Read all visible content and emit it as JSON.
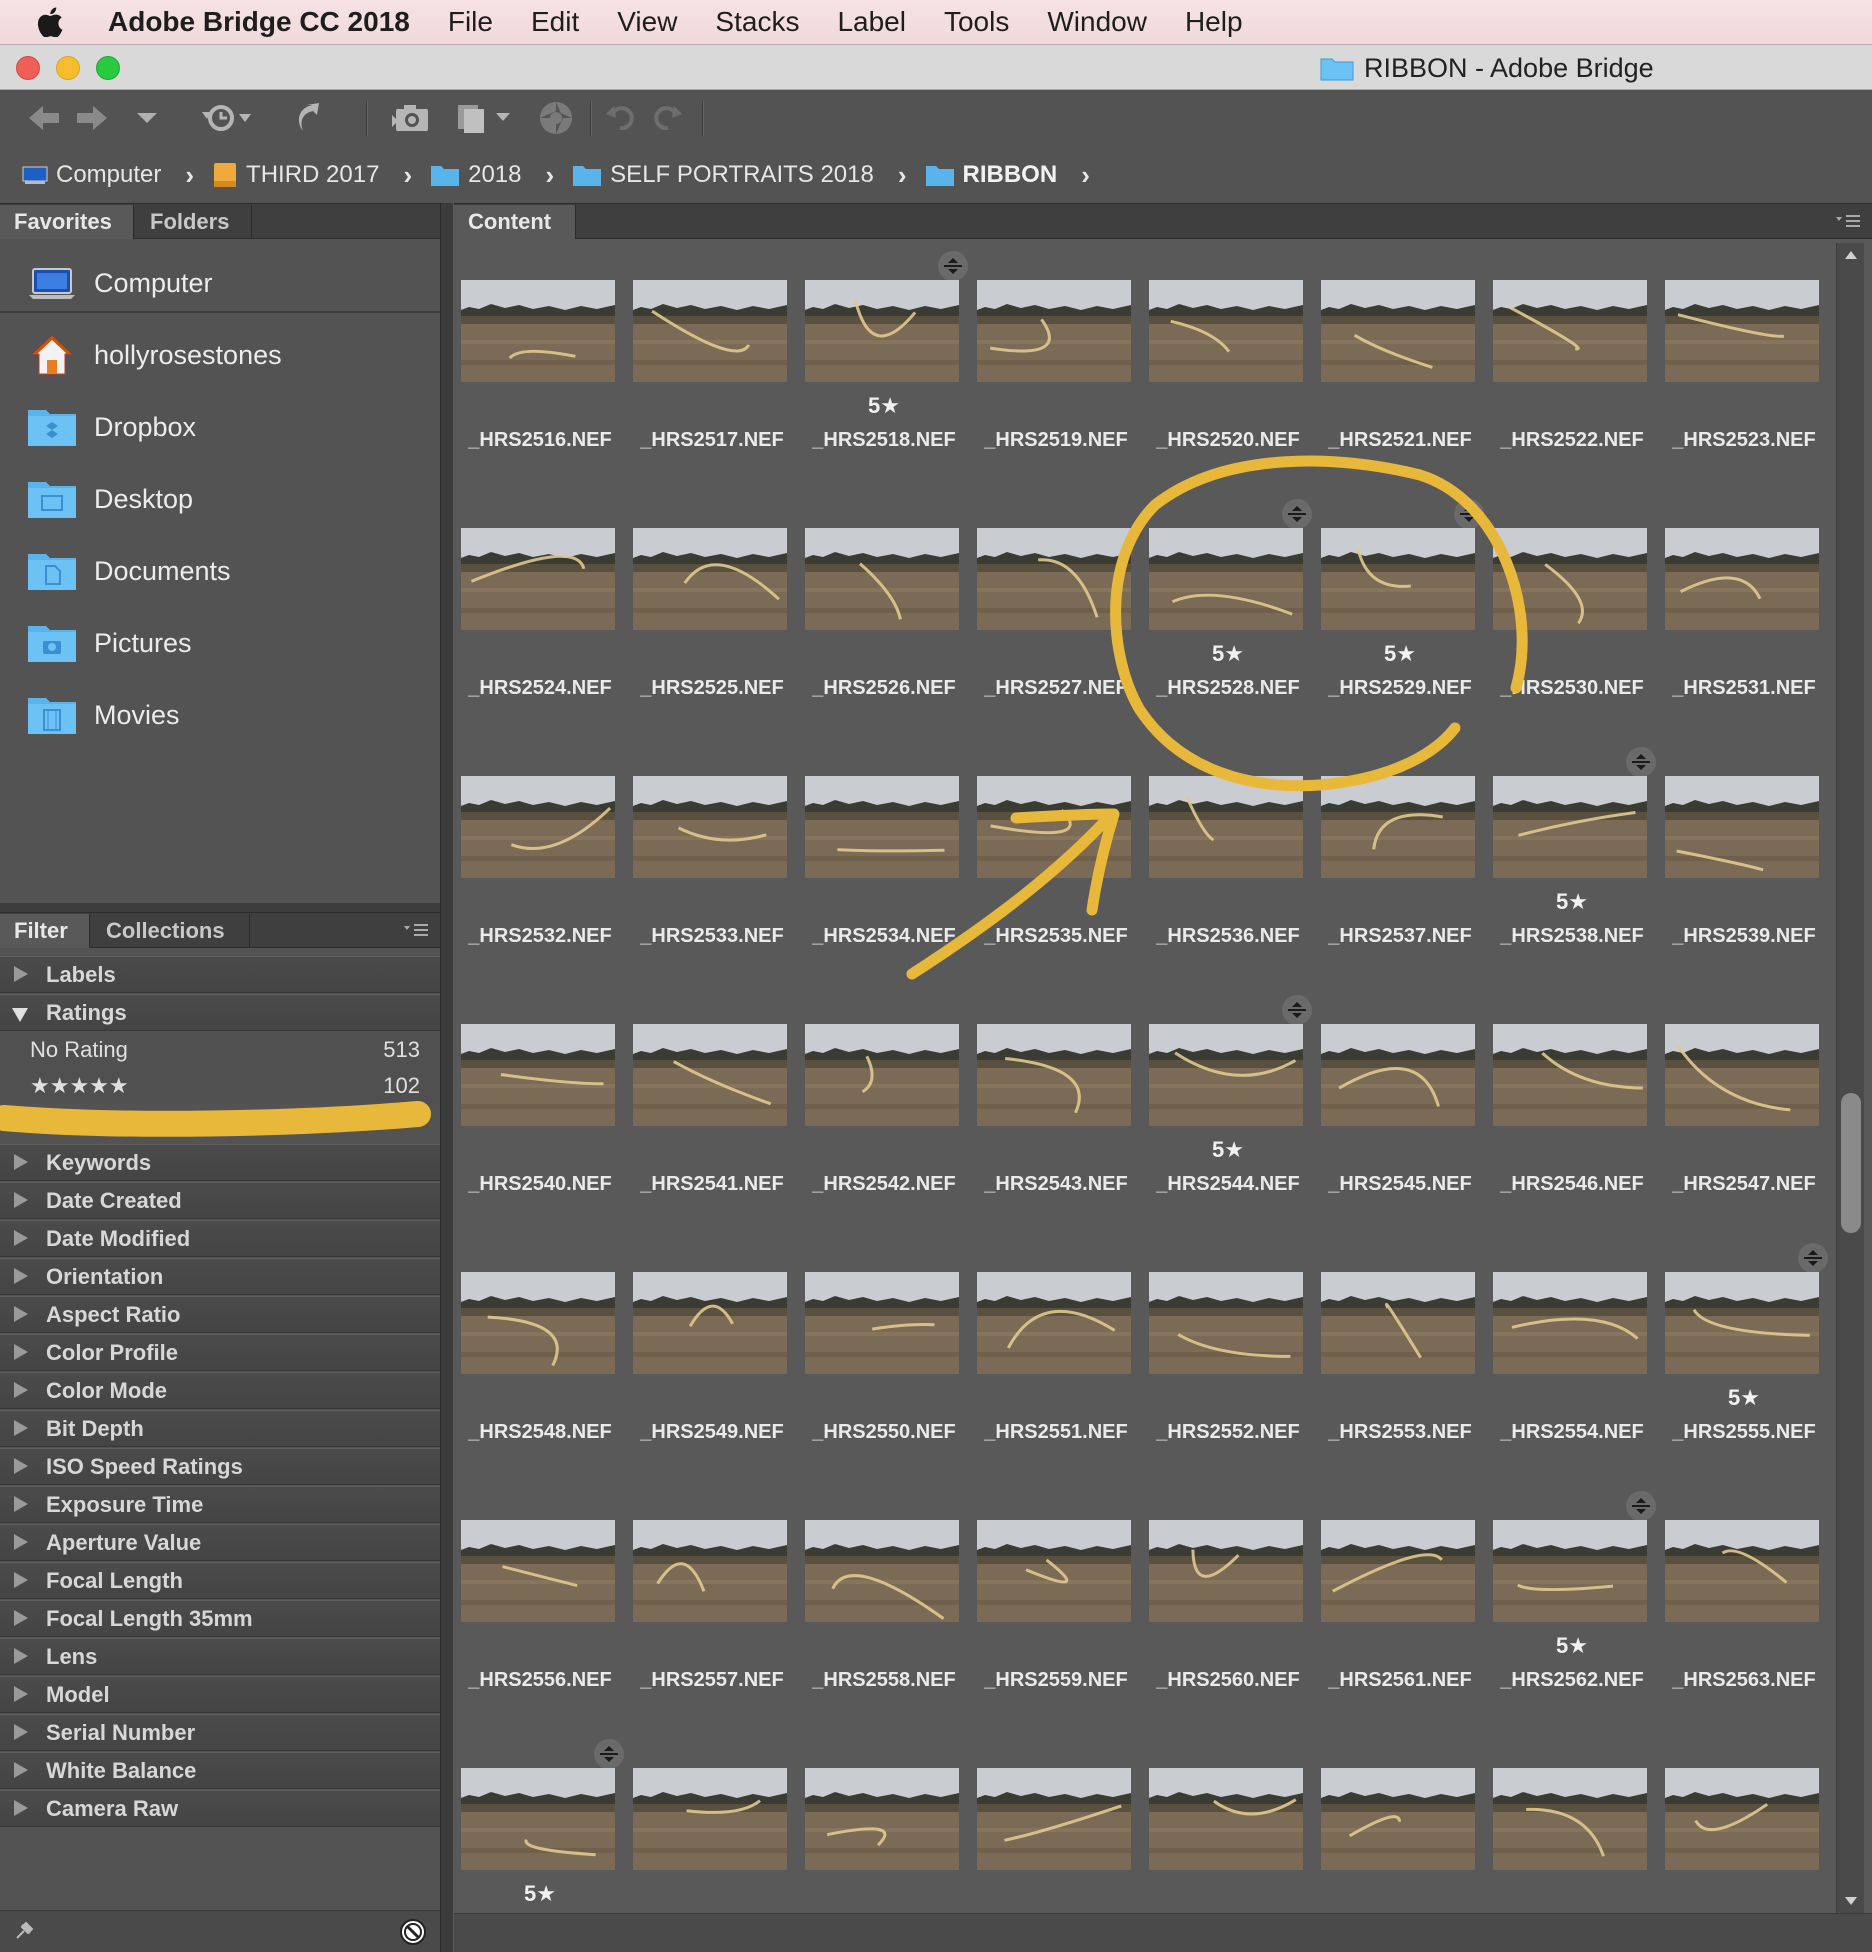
{
  "menubar": {
    "app_name": "Adobe Bridge CC 2018",
    "items": [
      "File",
      "Edit",
      "View",
      "Stacks",
      "Label",
      "Tools",
      "Window",
      "Help"
    ]
  },
  "window": {
    "title": "RIBBON - Adobe Bridge"
  },
  "breadcrumb": [
    {
      "label": "Computer",
      "icon": "computer-icon"
    },
    {
      "label": "THIRD 2017",
      "icon": "drive-icon"
    },
    {
      "label": "2018",
      "icon": "folder-icon"
    },
    {
      "label": "SELF PORTRAITS 2018",
      "icon": "folder-icon"
    },
    {
      "label": "RIBBON",
      "icon": "folder-icon"
    }
  ],
  "panels": {
    "top_left_tabs": [
      "Favorites",
      "Folders"
    ],
    "bottom_left_tabs": [
      "Filter",
      "Collections"
    ],
    "content_tab": "Content"
  },
  "favorites": [
    {
      "label": "Computer",
      "icon": "computer-icon"
    },
    {
      "label": "hollyrosestones",
      "icon": "home-icon"
    },
    {
      "label": "Dropbox",
      "icon": "dropbox-folder-icon"
    },
    {
      "label": "Desktop",
      "icon": "desktop-folder-icon"
    },
    {
      "label": "Documents",
      "icon": "documents-folder-icon"
    },
    {
      "label": "Pictures",
      "icon": "pictures-folder-icon"
    },
    {
      "label": "Movies",
      "icon": "movies-folder-icon"
    }
  ],
  "filter": {
    "labels_section": "Labels",
    "ratings_section": "Ratings",
    "ratings": [
      {
        "label": "No Rating",
        "count": "513"
      },
      {
        "label": "★★★★★",
        "count": "102"
      }
    ],
    "sections": [
      "Keywords",
      "Date Created",
      "Date Modified",
      "Orientation",
      "Aspect Ratio",
      "Color Profile",
      "Color Mode",
      "Bit Depth",
      "ISO Speed Ratings",
      "Exposure Time",
      "Aperture Value",
      "Focal Length",
      "Focal Length 35mm",
      "Lens",
      "Model",
      "Serial Number",
      "White Balance",
      "Camera Raw"
    ]
  },
  "content": {
    "rating_text": "5★",
    "items": [
      {
        "name": "_HRS2516.NEF",
        "rating": "",
        "stack": false
      },
      {
        "name": "_HRS2517.NEF",
        "rating": "",
        "stack": false
      },
      {
        "name": "_HRS2518.NEF",
        "rating": "5★",
        "stack": true
      },
      {
        "name": "_HRS2519.NEF",
        "rating": "",
        "stack": false
      },
      {
        "name": "_HRS2520.NEF",
        "rating": "",
        "stack": false
      },
      {
        "name": "_HRS2521.NEF",
        "rating": "",
        "stack": false
      },
      {
        "name": "_HRS2522.NEF",
        "rating": "",
        "stack": false
      },
      {
        "name": "_HRS2523.NEF",
        "rating": "",
        "stack": false
      },
      {
        "name": "_HRS2524.NEF",
        "rating": "",
        "stack": false
      },
      {
        "name": "_HRS2525.NEF",
        "rating": "",
        "stack": false
      },
      {
        "name": "_HRS2526.NEF",
        "rating": "",
        "stack": false
      },
      {
        "name": "_HRS2527.NEF",
        "rating": "",
        "stack": false
      },
      {
        "name": "_HRS2528.NEF",
        "rating": "5★",
        "stack": true
      },
      {
        "name": "_HRS2529.NEF",
        "rating": "5★",
        "stack": true
      },
      {
        "name": "_HRS2530.NEF",
        "rating": "",
        "stack": false
      },
      {
        "name": "_HRS2531.NEF",
        "rating": "",
        "stack": false
      },
      {
        "name": "_HRS2532.NEF",
        "rating": "",
        "stack": false
      },
      {
        "name": "_HRS2533.NEF",
        "rating": "",
        "stack": false
      },
      {
        "name": "_HRS2534.NEF",
        "rating": "",
        "stack": false
      },
      {
        "name": "_HRS2535.NEF",
        "rating": "",
        "stack": false
      },
      {
        "name": "_HRS2536.NEF",
        "rating": "",
        "stack": false
      },
      {
        "name": "_HRS2537.NEF",
        "rating": "",
        "stack": false
      },
      {
        "name": "_HRS2538.NEF",
        "rating": "5★",
        "stack": true
      },
      {
        "name": "_HRS2539.NEF",
        "rating": "",
        "stack": false
      },
      {
        "name": "_HRS2540.NEF",
        "rating": "",
        "stack": false
      },
      {
        "name": "_HRS2541.NEF",
        "rating": "",
        "stack": false
      },
      {
        "name": "_HRS2542.NEF",
        "rating": "",
        "stack": false
      },
      {
        "name": "_HRS2543.NEF",
        "rating": "",
        "stack": false
      },
      {
        "name": "_HRS2544.NEF",
        "rating": "5★",
        "stack": true
      },
      {
        "name": "_HRS2545.NEF",
        "rating": "",
        "stack": false
      },
      {
        "name": "_HRS2546.NEF",
        "rating": "",
        "stack": false
      },
      {
        "name": "_HRS2547.NEF",
        "rating": "",
        "stack": false
      },
      {
        "name": "_HRS2548.NEF",
        "rating": "",
        "stack": false
      },
      {
        "name": "_HRS2549.NEF",
        "rating": "",
        "stack": false
      },
      {
        "name": "_HRS2550.NEF",
        "rating": "",
        "stack": false
      },
      {
        "name": "_HRS2551.NEF",
        "rating": "",
        "stack": false
      },
      {
        "name": "_HRS2552.NEF",
        "rating": "",
        "stack": false
      },
      {
        "name": "_HRS2553.NEF",
        "rating": "",
        "stack": false
      },
      {
        "name": "_HRS2554.NEF",
        "rating": "",
        "stack": false
      },
      {
        "name": "_HRS2555.NEF",
        "rating": "5★",
        "stack": true
      },
      {
        "name": "_HRS2556.NEF",
        "rating": "",
        "stack": false
      },
      {
        "name": "_HRS2557.NEF",
        "rating": "",
        "stack": false
      },
      {
        "name": "_HRS2558.NEF",
        "rating": "",
        "stack": false
      },
      {
        "name": "_HRS2559.NEF",
        "rating": "",
        "stack": false
      },
      {
        "name": "_HRS2560.NEF",
        "rating": "",
        "stack": false
      },
      {
        "name": "_HRS2561.NEF",
        "rating": "",
        "stack": false
      },
      {
        "name": "_HRS2562.NEF",
        "rating": "5★",
        "stack": true
      },
      {
        "name": "_HRS2563.NEF",
        "rating": "",
        "stack": false
      },
      {
        "name": "",
        "rating": "5★",
        "stack": true
      },
      {
        "name": "",
        "rating": "",
        "stack": false
      },
      {
        "name": "",
        "rating": "",
        "stack": false
      },
      {
        "name": "",
        "rating": "",
        "stack": false
      },
      {
        "name": "",
        "rating": "",
        "stack": false
      },
      {
        "name": "",
        "rating": "",
        "stack": false
      },
      {
        "name": "",
        "rating": "",
        "stack": false
      },
      {
        "name": "",
        "rating": "",
        "stack": false
      }
    ]
  },
  "colors": {
    "panel_bg": "#535353",
    "content_bg": "#595959",
    "highlight_marker": "#e8b83a",
    "folder_blue": "#5ab4ec"
  }
}
